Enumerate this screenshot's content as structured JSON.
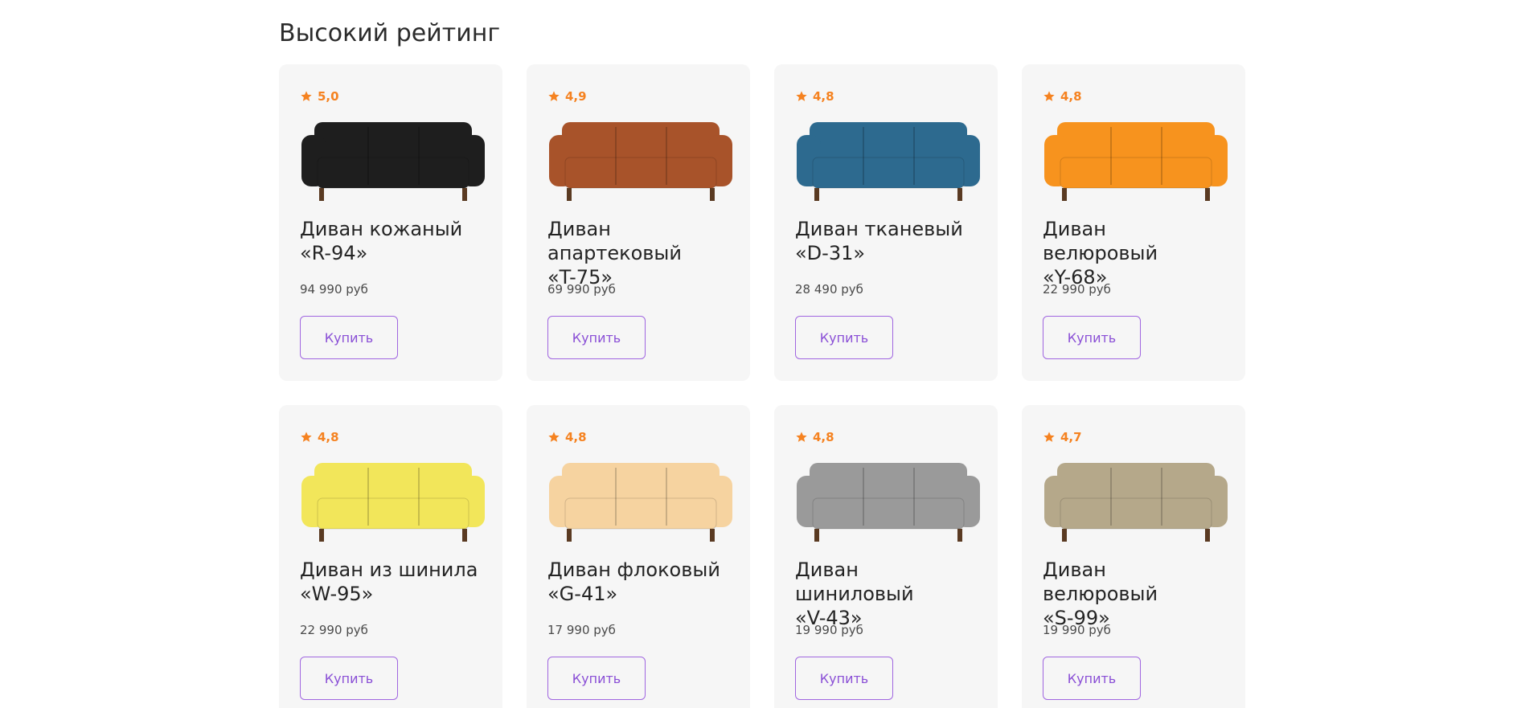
{
  "section": {
    "title": "Высокий рейтинг"
  },
  "colors": {
    "card_background": "#f6f6f6",
    "rating_accent": "#f58220",
    "button_accent": "#a066e0",
    "text_primary": "#242424"
  },
  "products": [
    {
      "rating": "5,0",
      "title_line1": "Диван кожаный",
      "title_line2": "«R-94»",
      "price": "94 990 руб",
      "button_label": "Купить",
      "icon": "black-leather-chesterfield-sofa",
      "sofa_color": "#1e1e1e"
    },
    {
      "rating": "4,9",
      "title_line1": "Диван апартековый",
      "title_line2": "«T-75»",
      "price": "69 990 руб",
      "button_label": "Купить",
      "icon": "brown-leather-sofa",
      "sofa_color": "#a8532a"
    },
    {
      "rating": "4,8",
      "title_line1": "Диван тканевый",
      "title_line2": "«D-31»",
      "price": "28 490 руб",
      "button_label": "Купить",
      "icon": "blue-fabric-sofa",
      "sofa_color": "#2d6a8f"
    },
    {
      "rating": "4,8",
      "title_line1": "Диван велюровый",
      "title_line2": "«Y-68»",
      "price": "22 990 руб",
      "button_label": "Купить",
      "icon": "orange-velour-sofa",
      "sofa_color": "#f7931e"
    },
    {
      "rating": "4,8",
      "title_line1": "Диван из шинила",
      "title_line2": "«W-95»",
      "price": "22 990 руб",
      "button_label": "Купить",
      "icon": "yellow-chenille-sofa",
      "sofa_color": "#f2e65a"
    },
    {
      "rating": "4,8",
      "title_line1": "Диван флоковый",
      "title_line2": "«G-41»",
      "price": "17 990 руб",
      "button_label": "Купить",
      "icon": "peach-flock-sofa",
      "sofa_color": "#f6d3a0"
    },
    {
      "rating": "4,8",
      "title_line1": "Диван шиниловый",
      "title_line2": "«V-43»",
      "price": "19 990 руб",
      "button_label": "Купить",
      "icon": "grey-chenille-sofa",
      "sofa_color": "#9a9a9a"
    },
    {
      "rating": "4,7",
      "title_line1": "Диван велюровый",
      "title_line2": "«S-99»",
      "price": "19 990 руб",
      "button_label": "Купить",
      "icon": "beige-velour-sofa",
      "sofa_color": "#b5a88a"
    }
  ]
}
